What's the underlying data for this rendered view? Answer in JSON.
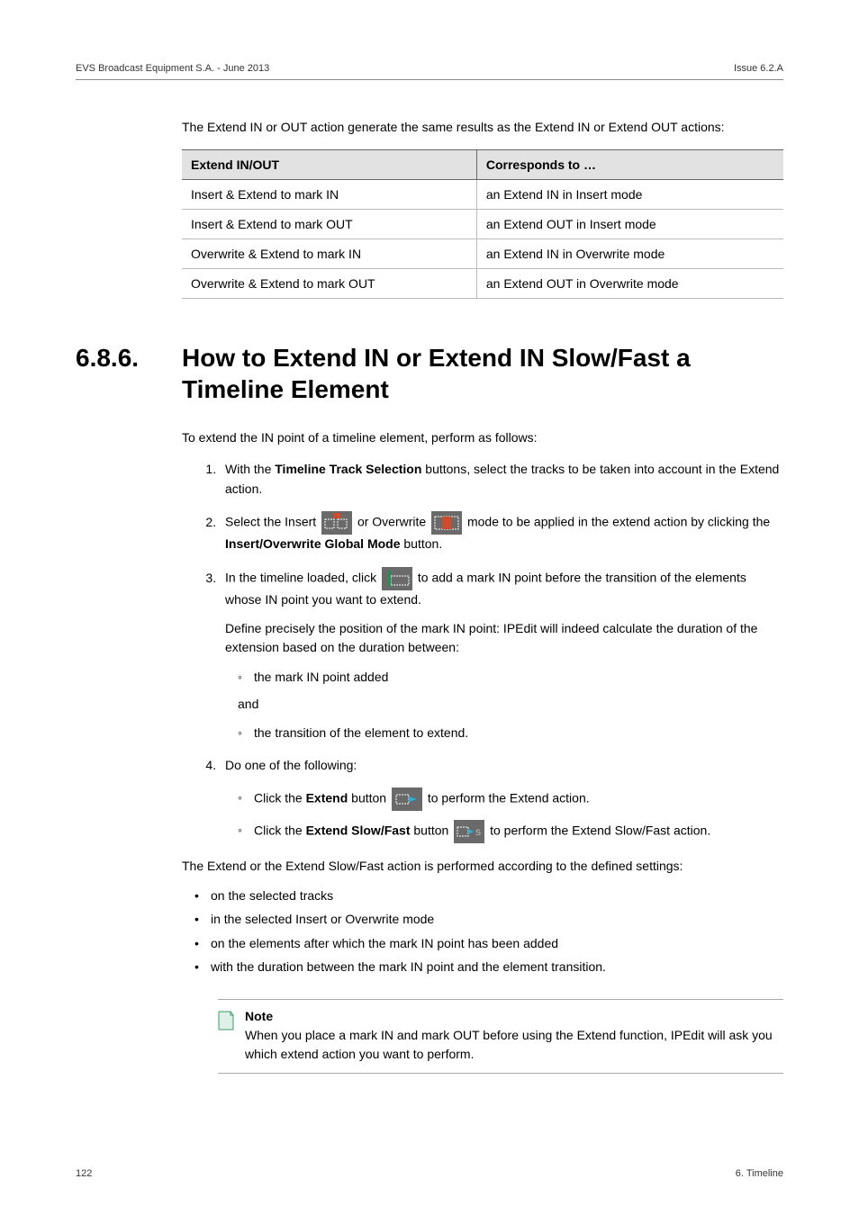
{
  "header": {
    "left": "EVS Broadcast Equipment S.A. - June 2013",
    "right": "Issue 6.2.A"
  },
  "paragraph1": "The Extend IN or OUT action generate the same results as the Extend IN or Extend OUT actions:",
  "table": {
    "head": {
      "c1": "Extend IN/OUT",
      "c2": "Corresponds to …"
    },
    "rows": [
      {
        "c1": "Insert & Extend to mark IN",
        "c2": "an Extend IN in Insert mode"
      },
      {
        "c1": "Insert & Extend to mark OUT",
        "c2": "an Extend OUT in Insert mode"
      },
      {
        "c1": "Overwrite & Extend to mark IN",
        "c2": "an Extend IN in Overwrite mode"
      },
      {
        "c1": "Overwrite & Extend to mark OUT",
        "c2": "an Extend OUT in Overwrite mode"
      }
    ]
  },
  "section": {
    "num": "6.8.6.",
    "title": "How to Extend IN or Extend IN Slow/Fast a Timeline Element"
  },
  "intro2": "To extend the IN point of a timeline element, perform as follows:",
  "steps": {
    "s1": {
      "pre": "With the ",
      "bold": "Timeline Track Selection",
      "post": " buttons, select the tracks to be taken into account in the Extend action."
    },
    "s2": {
      "a": "Select the Insert ",
      "b": " or Overwrite ",
      "c": " mode to be applied in the extend action by clicking the ",
      "bold": "Insert/Overwrite Global Mode",
      "d": " button."
    },
    "s3": {
      "a": "In the timeline loaded, click ",
      "b": " to add a mark IN point before the transition of the elements whose IN point you want to extend.",
      "p2": "Define precisely the position of the mark IN point: IPEdit will indeed calculate the duration of the extension based on the duration between:",
      "bullet1": "the mark IN point added",
      "and": "and",
      "bullet2": "the transition of the element to extend."
    },
    "s4": {
      "lead": "Do one of the following:",
      "b1": {
        "pre": "Click the ",
        "bold": "Extend",
        "mid": " button ",
        "post": " to perform the Extend action."
      },
      "b2": {
        "pre": "Click the ",
        "bold": "Extend Slow/Fast",
        "mid": " button ",
        "post": " to perform the Extend Slow/Fast action."
      }
    }
  },
  "closing": "The Extend or the Extend Slow/Fast action is performed according to the defined settings:",
  "closing_bullets": [
    "on the selected tracks",
    "in the selected Insert or Overwrite mode",
    "on the elements after which the mark IN point has been added",
    "with the duration between the mark IN point and the element transition."
  ],
  "note": {
    "title": "Note",
    "body": "When you place a mark IN and mark OUT before using the Extend function, IPEdit will ask you which extend action you want to perform."
  },
  "footer": {
    "left": "122",
    "right": "6. Timeline"
  }
}
